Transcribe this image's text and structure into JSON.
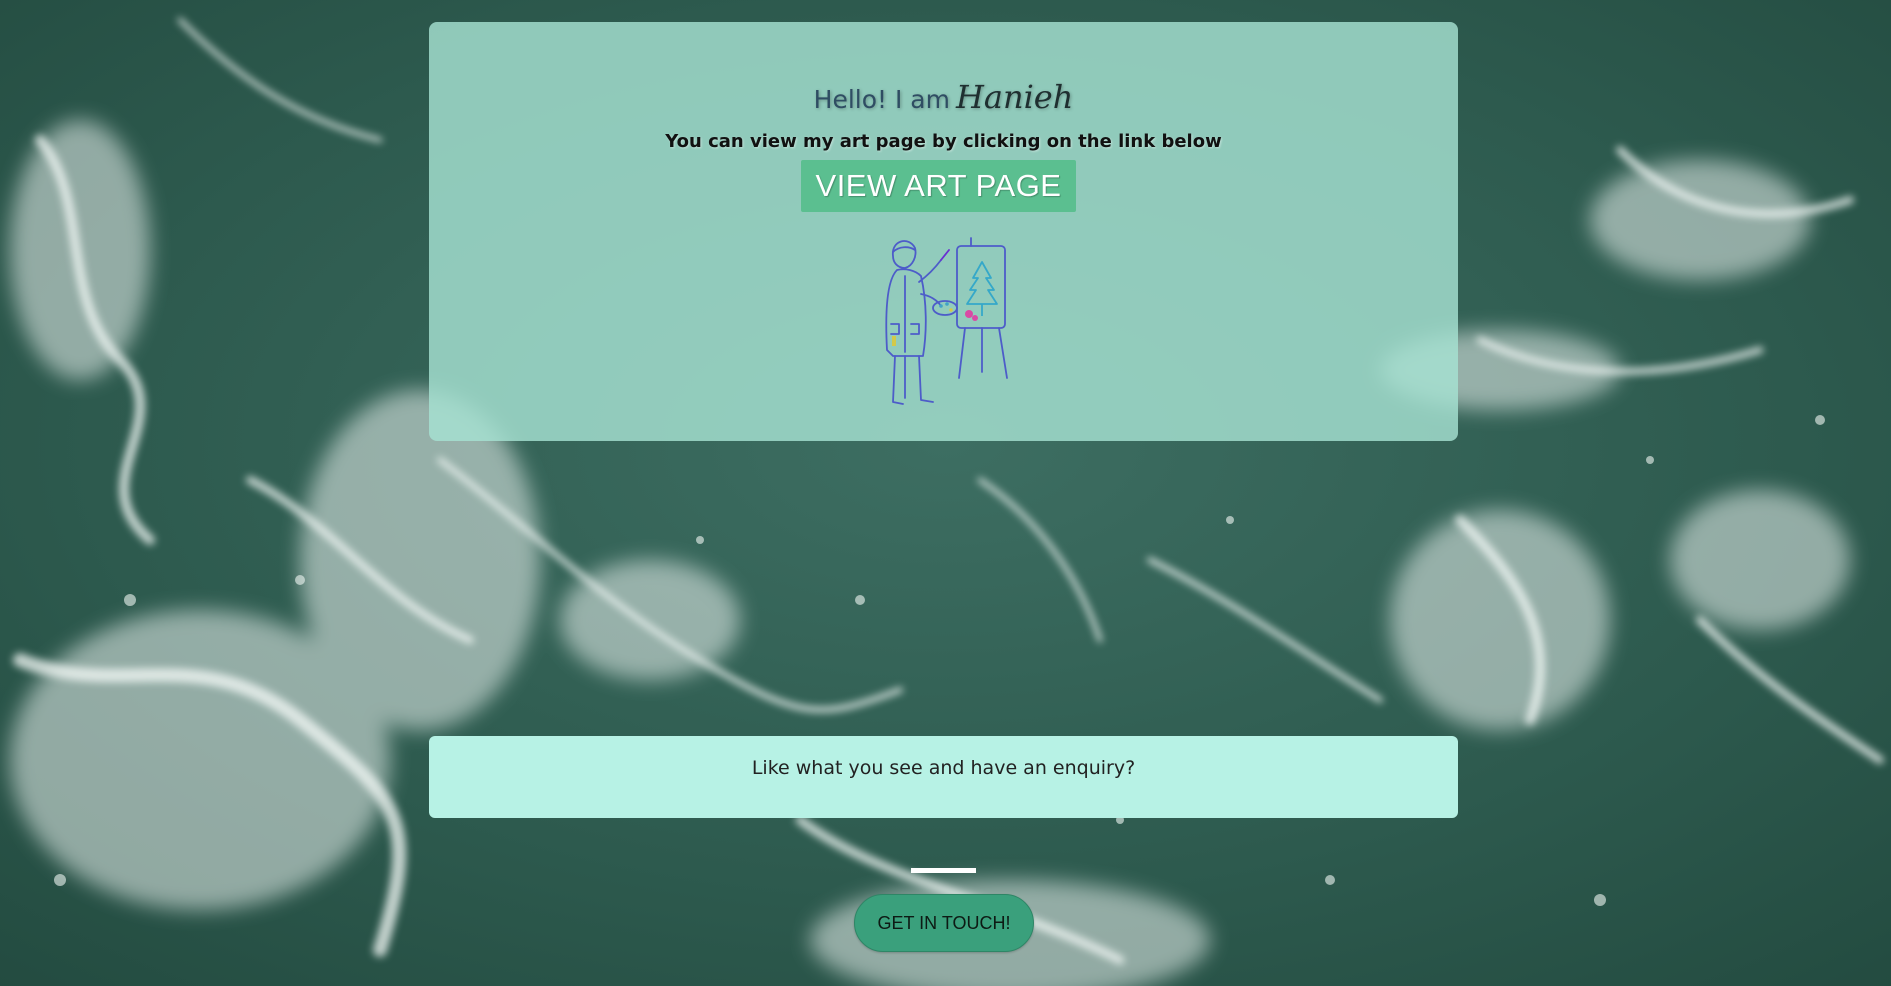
{
  "hero": {
    "greeting_prefix": "Hello! I am",
    "name": "Hanieh",
    "subtitle": "You can view my art page by clicking on the link below",
    "art_button_label": "VIEW ART PAGE"
  },
  "enquiry": {
    "text": "Like what you see and have an enquiry?"
  },
  "contact": {
    "button_label": "GET IN TOUCH!"
  },
  "colors": {
    "hero_card": "#a6e2d2",
    "art_button": "#5bbf90",
    "enquiry_card": "#b7f2e5",
    "contact_button": "#3aa07c"
  }
}
